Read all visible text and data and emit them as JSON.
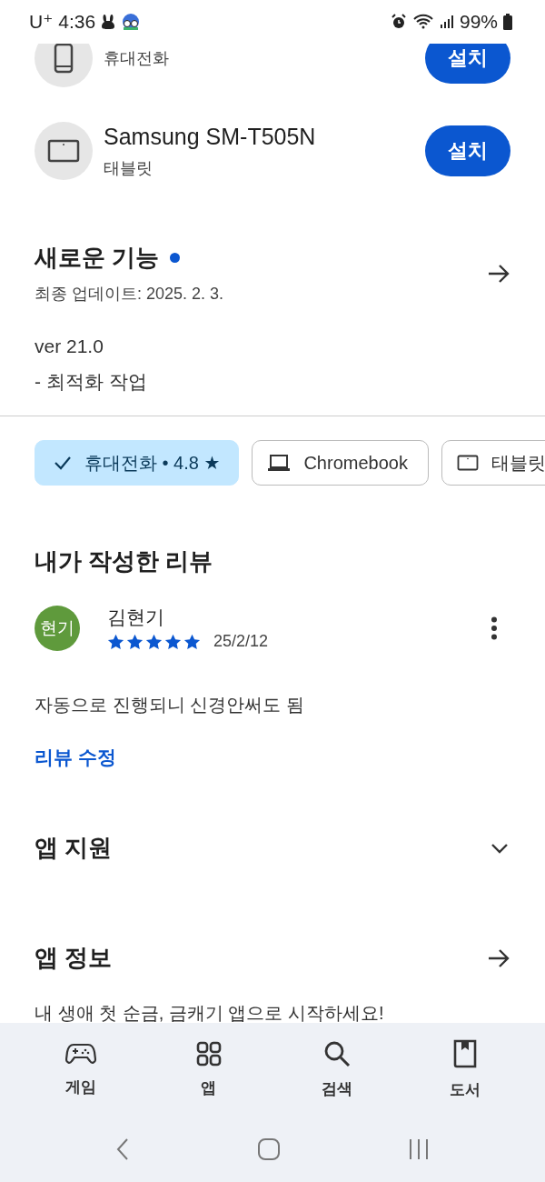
{
  "status_bar": {
    "carrier": "U⁺",
    "time": "4:36",
    "battery": "99%"
  },
  "devices": [
    {
      "kind": "phone",
      "subtitle": "휴대전화",
      "button": "설치"
    },
    {
      "kind": "tablet",
      "name": "Samsung SM-T505N",
      "subtitle": "태블릿",
      "button": "설치"
    }
  ],
  "whats_new": {
    "title": "새로운 기능",
    "new": true,
    "updated": "최종 업데이트: 2025. 2. 3.",
    "notes": [
      "ver 21.0",
      "- 최적화 작업"
    ]
  },
  "device_chips": [
    {
      "label": "휴대전화 • 4.8 ★",
      "selected": true
    },
    {
      "kind": "laptop",
      "label": "Chromebook",
      "selected": false
    },
    {
      "kind": "tablet",
      "label": "태블릿",
      "selected": false
    }
  ],
  "my_review": {
    "title": "내가 작성한 리뷰",
    "avatar": "현기",
    "color": "#5f9a3c",
    "name": "김현기",
    "stars": 5,
    "date": "25/2/12",
    "text": "자동으로 진행되니 신경안써도 됨",
    "edit": "리뷰 수정"
  },
  "sections": [
    {
      "kind": "expand",
      "title": "앱 지원",
      "expanded": false
    },
    {
      "kind": "link",
      "title": "앱 정보",
      "description": "내 생애 첫 순금, 금캐기 앱으로 시작하세요!"
    }
  ],
  "bottom_nav": [
    {
      "kind": "games",
      "label": "게임"
    },
    {
      "kind": "apps",
      "label": "앱"
    },
    {
      "kind": "search",
      "label": "검색"
    },
    {
      "kind": "books",
      "label": "도서"
    }
  ]
}
